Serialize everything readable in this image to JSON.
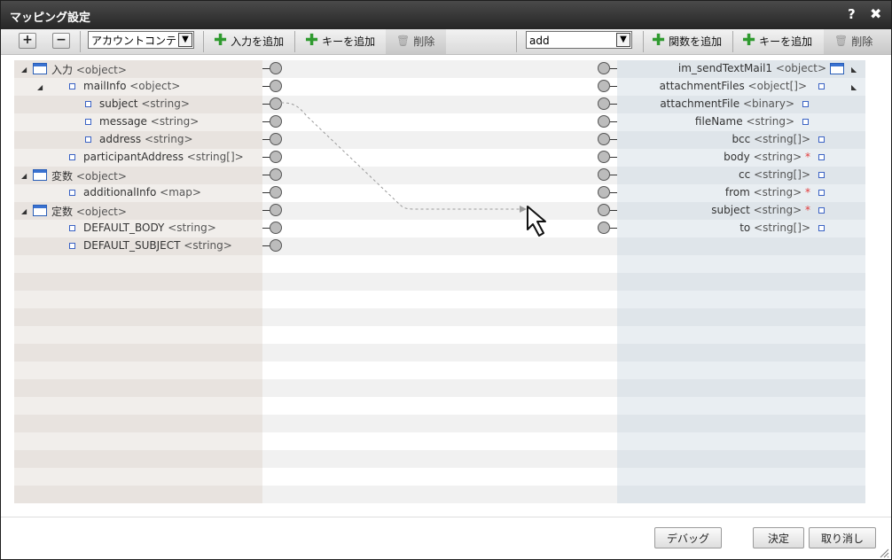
{
  "window": {
    "title": "マッピング設定",
    "help_label": "?",
    "close_label": "✖"
  },
  "toolbar": {
    "expand_label": "+",
    "collapse_label": "−",
    "context_select_value": "アカウントコンテ",
    "add_input_label": "入力を追加",
    "add_key_left_label": "キーを追加",
    "delete_left_label": "削除",
    "function_select_value": "add",
    "add_function_label": "関数を追加",
    "add_key_right_label": "キーを追加",
    "delete_right_label": "削除"
  },
  "left_tree": [
    {
      "label": "入力",
      "type": "<object>",
      "level": 0,
      "kind": "object",
      "expanded": true
    },
    {
      "label": "mailInfo",
      "type": "<object>",
      "level": 1,
      "kind": "node",
      "expanded": true
    },
    {
      "label": "subject",
      "type": "<string>",
      "level": 2,
      "kind": "node"
    },
    {
      "label": "message",
      "type": "<string>",
      "level": 2,
      "kind": "node"
    },
    {
      "label": "address",
      "type": "<string>",
      "level": 2,
      "kind": "node"
    },
    {
      "label": "participantAddress",
      "type": "<string[]>",
      "level": 1,
      "kind": "node"
    },
    {
      "label": "変数",
      "type": "<object>",
      "level": 0,
      "kind": "object",
      "expanded": true
    },
    {
      "label": "additionalInfo",
      "type": "<map>",
      "level": 1,
      "kind": "node"
    },
    {
      "label": "定数",
      "type": "<object>",
      "level": 0,
      "kind": "object",
      "expanded": true
    },
    {
      "label": "DEFAULT_BODY",
      "type": "<string>",
      "level": 1,
      "kind": "node"
    },
    {
      "label": "DEFAULT_SUBJECT",
      "type": "<string>",
      "level": 1,
      "kind": "node"
    }
  ],
  "right_tree": [
    {
      "label": "im_sendTextMail1",
      "type": "<object>",
      "required": false,
      "kind": "object",
      "expanded": true
    },
    {
      "label": "attachmentFiles",
      "type": "<object[]>",
      "required": false,
      "kind": "node",
      "expanded": true
    },
    {
      "label": "attachmentFile",
      "type": "<binary>",
      "required": false,
      "kind": "node",
      "indent": 2
    },
    {
      "label": "fileName",
      "type": "<string>",
      "required": false,
      "kind": "node",
      "indent": 2
    },
    {
      "label": "bcc",
      "type": "<string[]>",
      "required": false,
      "kind": "node",
      "indent": 1
    },
    {
      "label": "body",
      "type": "<string>",
      "required": true,
      "kind": "node",
      "indent": 1
    },
    {
      "label": "cc",
      "type": "<string[]>",
      "required": false,
      "kind": "node",
      "indent": 1
    },
    {
      "label": "from",
      "type": "<string>",
      "required": true,
      "kind": "node",
      "indent": 1
    },
    {
      "label": "subject",
      "type": "<string>",
      "required": true,
      "kind": "node",
      "indent": 1
    },
    {
      "label": "to",
      "type": "<string[]>",
      "required": false,
      "kind": "node",
      "indent": 1
    }
  ],
  "required_mark": "*",
  "colors": {
    "accent_blue": "#3a72d1",
    "required_red": "#e23b3b",
    "add_green": "#2f9a2f"
  },
  "footer": {
    "debug_label": "デバッグ",
    "ok_label": "決定",
    "cancel_label": "取り消し"
  }
}
